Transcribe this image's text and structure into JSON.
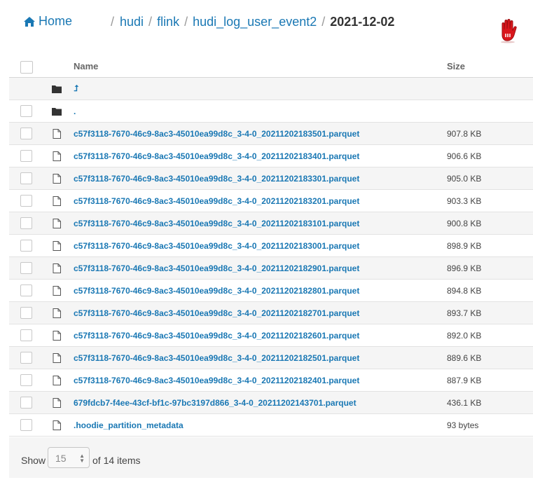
{
  "header": {
    "home_label": "Home",
    "breadcrumbs": [
      "hudi",
      "flink",
      "hudi_log_user_event2"
    ],
    "current": "2021-12-02"
  },
  "table": {
    "columns": {
      "name": "Name",
      "size": "Size"
    },
    "parent_link": "⮥",
    "rows": [
      {
        "type": "folder",
        "name": ".",
        "size": ""
      },
      {
        "type": "file",
        "name": "c57f3118-7670-46c9-8ac3-45010ea99d8c_3-4-0_20211202183501.parquet",
        "size": "907.8 KB"
      },
      {
        "type": "file",
        "name": "c57f3118-7670-46c9-8ac3-45010ea99d8c_3-4-0_20211202183401.parquet",
        "size": "906.6 KB"
      },
      {
        "type": "file",
        "name": "c57f3118-7670-46c9-8ac3-45010ea99d8c_3-4-0_20211202183301.parquet",
        "size": "905.0 KB"
      },
      {
        "type": "file",
        "name": "c57f3118-7670-46c9-8ac3-45010ea99d8c_3-4-0_20211202183201.parquet",
        "size": "903.3 KB"
      },
      {
        "type": "file",
        "name": "c57f3118-7670-46c9-8ac3-45010ea99d8c_3-4-0_20211202183101.parquet",
        "size": "900.8 KB"
      },
      {
        "type": "file",
        "name": "c57f3118-7670-46c9-8ac3-45010ea99d8c_3-4-0_20211202183001.parquet",
        "size": "898.9 KB"
      },
      {
        "type": "file",
        "name": "c57f3118-7670-46c9-8ac3-45010ea99d8c_3-4-0_20211202182901.parquet",
        "size": "896.9 KB"
      },
      {
        "type": "file",
        "name": "c57f3118-7670-46c9-8ac3-45010ea99d8c_3-4-0_20211202182801.parquet",
        "size": "894.8 KB"
      },
      {
        "type": "file",
        "name": "c57f3118-7670-46c9-8ac3-45010ea99d8c_3-4-0_20211202182701.parquet",
        "size": "893.7 KB"
      },
      {
        "type": "file",
        "name": "c57f3118-7670-46c9-8ac3-45010ea99d8c_3-4-0_20211202182601.parquet",
        "size": "892.0 KB"
      },
      {
        "type": "file",
        "name": "c57f3118-7670-46c9-8ac3-45010ea99d8c_3-4-0_20211202182501.parquet",
        "size": "889.6 KB"
      },
      {
        "type": "file",
        "name": "c57f3118-7670-46c9-8ac3-45010ea99d8c_3-4-0_20211202182401.parquet",
        "size": "887.9 KB"
      },
      {
        "type": "file",
        "name": "679fdcb7-f4ee-43cf-bf1c-97bc3197d866_3-4-0_20211202143701.parquet",
        "size": "436.1 KB"
      },
      {
        "type": "file",
        "name": ".hoodie_partition_metadata",
        "size": "93 bytes"
      }
    ]
  },
  "footer": {
    "show_label": "Show",
    "page_size": "15",
    "total_label": "of 14 items"
  },
  "icons": {
    "home": "home-icon",
    "folder": "folder-icon",
    "file": "file-icon",
    "parent": "parent-directory-icon",
    "hand": "red-hand-icon"
  },
  "colors": {
    "link": "#1a78b4",
    "stripe": "#f5f5f5",
    "hand": "#d9161c"
  }
}
